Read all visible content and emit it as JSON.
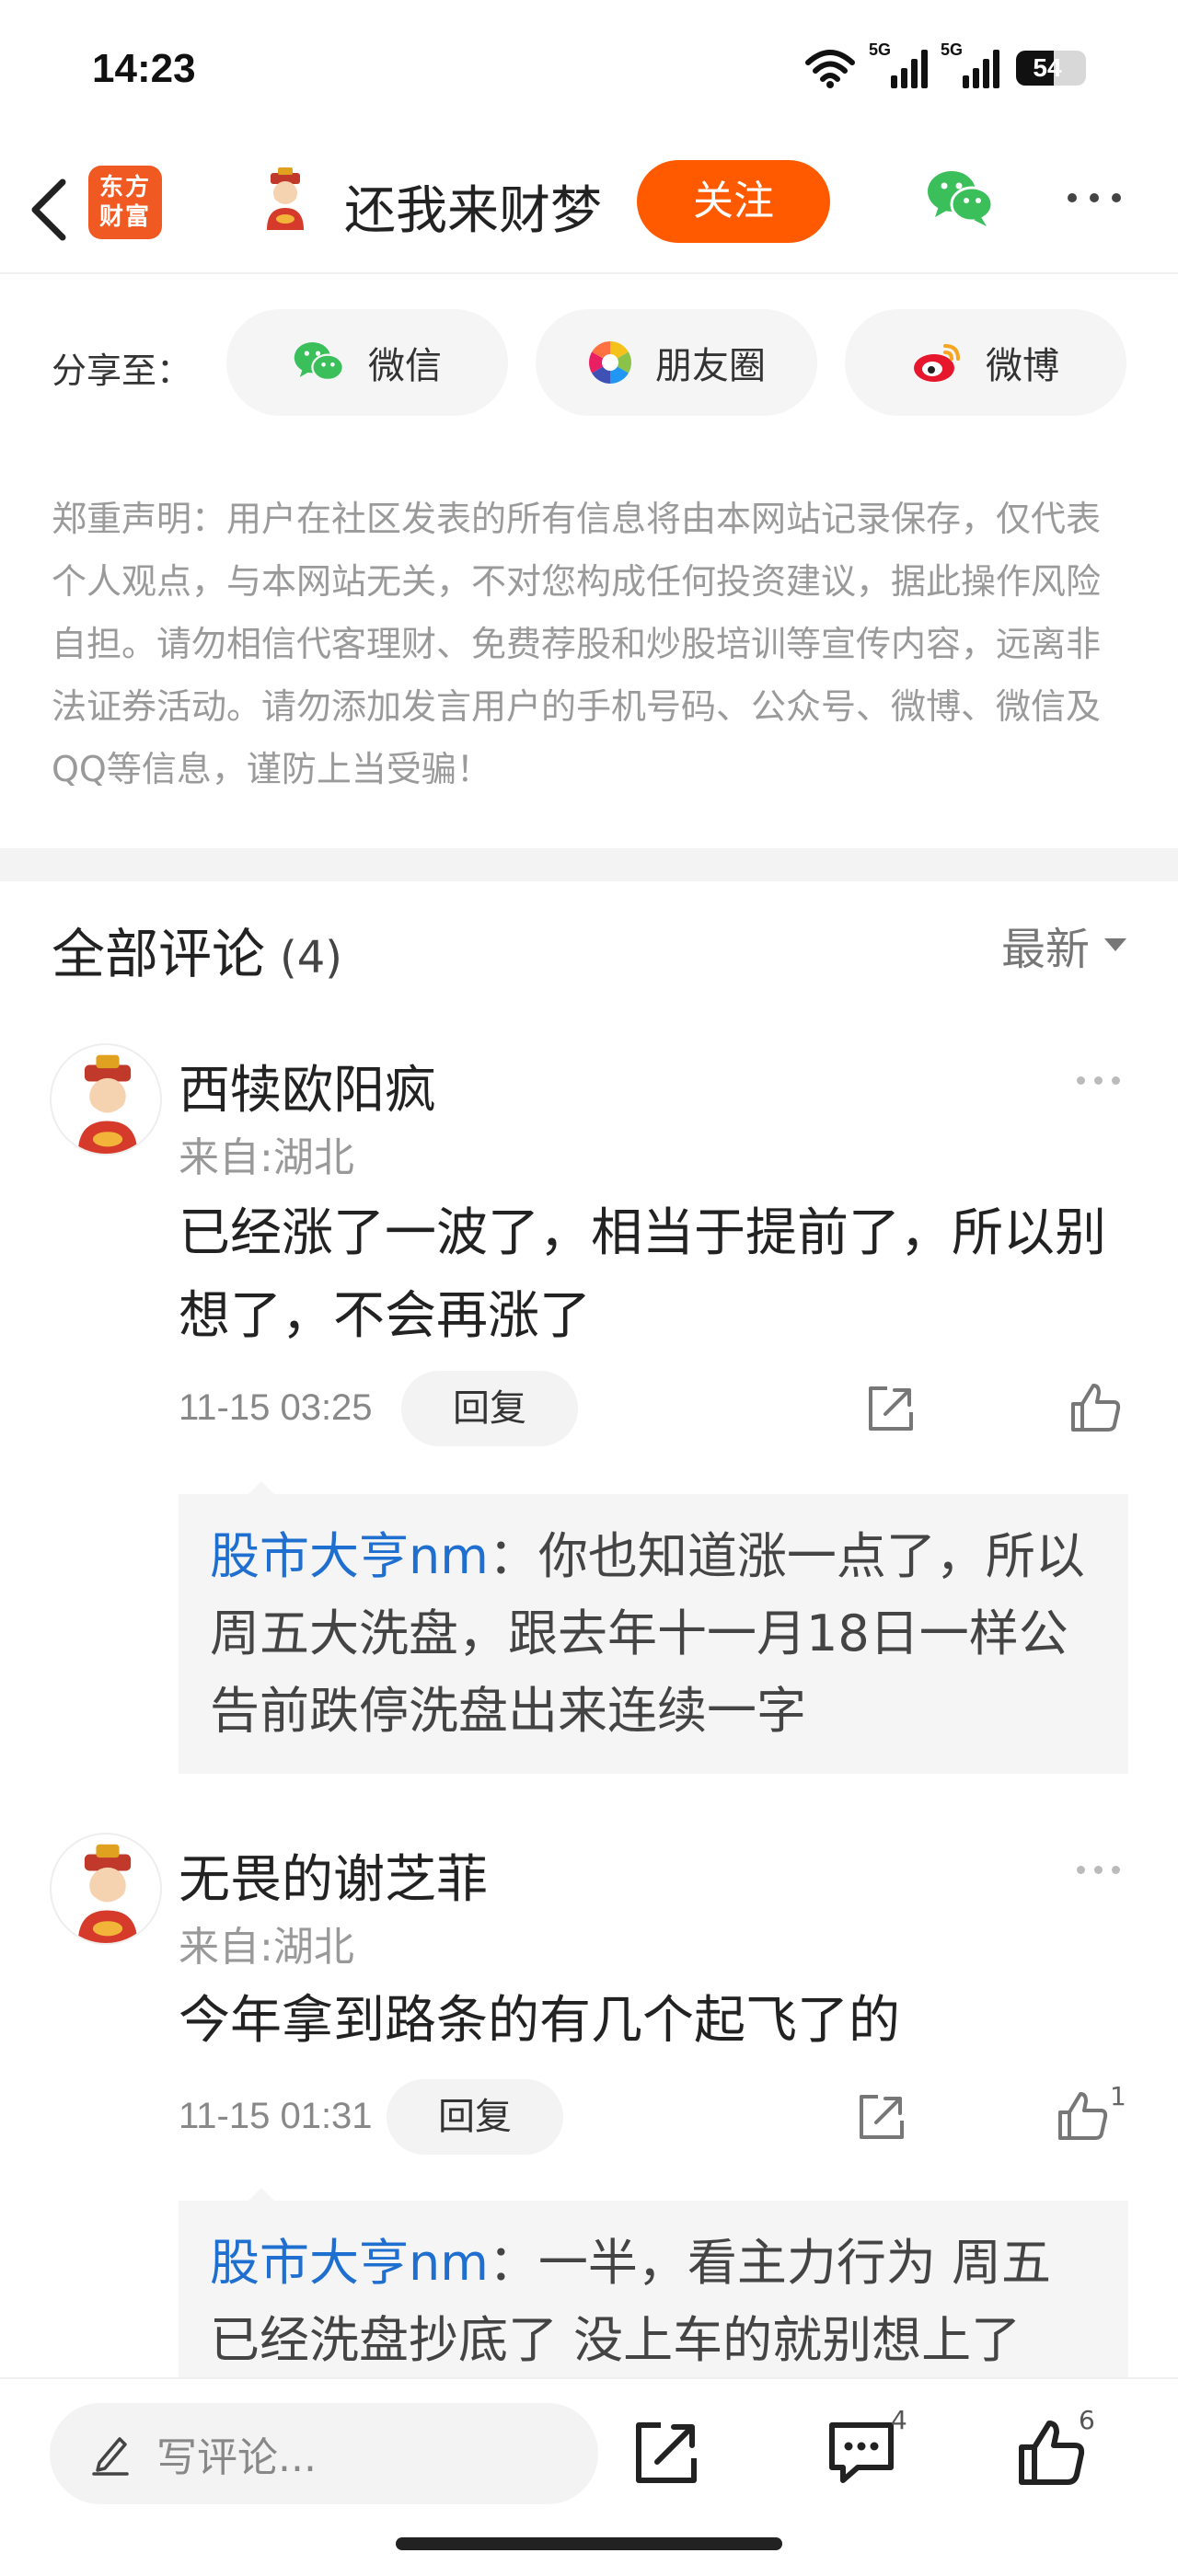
{
  "status_bar": {
    "time": "14:23",
    "net1": "5G",
    "net2": "5G",
    "battery": "54",
    "battery_level": 0.54
  },
  "header": {
    "brand_logo_line1": "东方",
    "brand_logo_line2": "财富",
    "user_name": "还我来财梦",
    "follow_label": "关注"
  },
  "share": {
    "label": "分享至：",
    "wechat": "微信",
    "moments": "朋友圈",
    "weibo": "微博"
  },
  "disclaimer": "郑重声明：用户在社区发表的所有信息将由本网站记录保存，仅代表个人观点，与本网站无关，不对您构成任何投资建议，据此操作风险自担。请勿相信代客理财、免费荐股和炒股培训等宣传内容，远离非法证券活动。请勿添加发言用户的手机号码、公众号、微博、微信及QQ等信息，谨防上当受骗！",
  "comments_header": {
    "title": "全部评论",
    "count": "(4)",
    "sort": "最新"
  },
  "comments": [
    {
      "author": "西犊欧阳疯",
      "location": "来自:湖北",
      "text": "已经涨了一波了，相当于提前了，所以别想了，不会再涨了",
      "time": "11-15 03:25",
      "reply_label": "回复",
      "like_count": "",
      "reply": {
        "author": "股市大亨nm",
        "sep": "：",
        "text": "你也知道涨一点了，所以周五大洗盘，跟去年十一月18日一样公告前跌停洗盘出来连续一字"
      }
    },
    {
      "author": "无畏的谢芝菲",
      "location": "来自:湖北",
      "text": "今年拿到路条的有几个起飞了的",
      "time": "11-15 01:31",
      "reply_label": "回复",
      "like_count": "1",
      "reply": {
        "author": "股市大亨nm",
        "sep": "：",
        "text": "一半，看主力行为 周五已经洗盘抄底了 没上车的就别想上了"
      }
    }
  ],
  "bottom_bar": {
    "input_placeholder": "写评论...",
    "comment_count": "4",
    "like_count": "6"
  },
  "colors": {
    "accent": "#ff5a00",
    "reply_name": "#1f6fd1"
  }
}
